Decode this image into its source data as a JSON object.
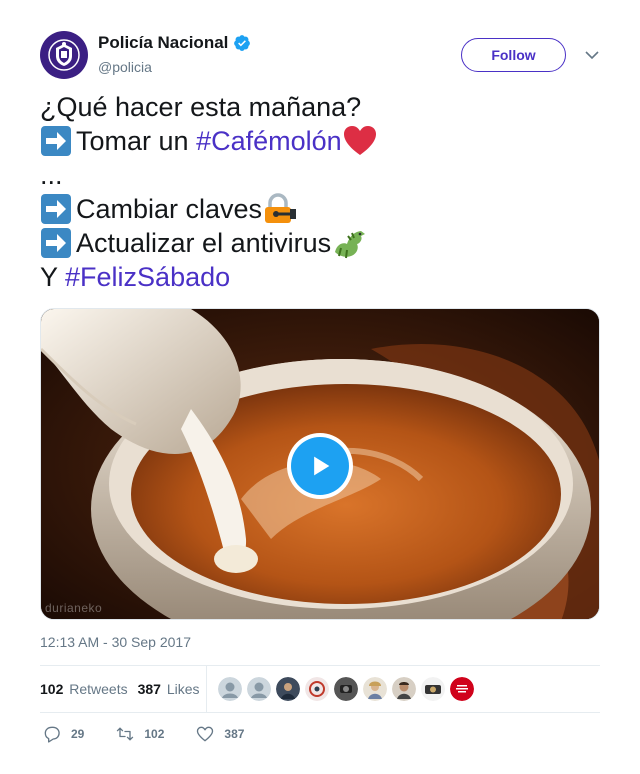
{
  "account": {
    "name": "Policía Nacional",
    "handle": "@policia",
    "verified": true,
    "follow_label": "Follow"
  },
  "tweet": {
    "lines": [
      {
        "text": "¿Qué hacer esta mañana?"
      },
      {
        "prefix_icon": "right-arrow-emoji",
        "text": "Tomar un ",
        "hashtag": "#Cafémolón",
        "suffix_icon": "red-heart-emoji"
      },
      {
        "text": "..."
      },
      {
        "prefix_icon": "right-arrow-emoji",
        "text": "Cambiar claves",
        "suffix_icon": "lock-with-key-emoji"
      },
      {
        "prefix_icon": "right-arrow-emoji",
        "text": "Actualizar el antivirus",
        "suffix_icon": "dragon-emoji"
      },
      {
        "text": "Y ",
        "hashtag": "#FelizSábado"
      }
    ],
    "media": {
      "type": "gif",
      "watermark": "durianeko",
      "play_icon": "play-icon"
    },
    "timestamp": "12:13 AM - 30 Sep 2017"
  },
  "stats": {
    "retweets_count": "102",
    "retweets_label": "Retweets",
    "likes_count": "387",
    "likes_label": "Likes"
  },
  "actions": {
    "reply_count": "29",
    "retweet_count": "102",
    "like_count": "387"
  },
  "colors": {
    "link": "#4a31c6",
    "brand": "#3b1f83",
    "play": "#1da1f2",
    "muted": "#657786"
  }
}
